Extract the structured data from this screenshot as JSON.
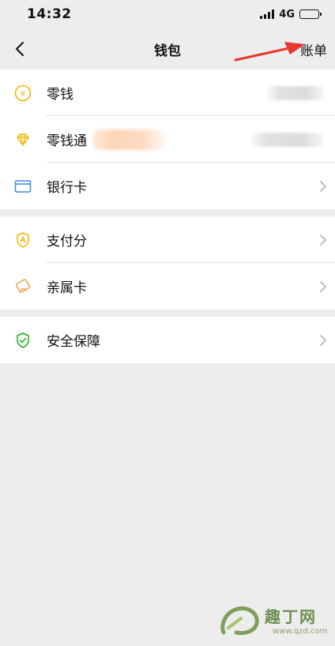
{
  "status_bar": {
    "time": "14:32",
    "network": "4G",
    "battery_level": 0.3
  },
  "nav": {
    "title": "钱包",
    "action": "账单"
  },
  "groups": [
    [
      {
        "label": "零钱",
        "icon": "yen-coin-icon"
      },
      {
        "label": "零钱通",
        "icon": "diamond-icon"
      },
      {
        "label": "银行卡",
        "icon": "bank-card-icon"
      }
    ],
    [
      {
        "label": "支付分",
        "icon": "payscore-badge-icon"
      },
      {
        "label": "亲属卡",
        "icon": "family-card-icon"
      }
    ],
    [
      {
        "label": "安全保障",
        "icon": "shield-check-icon"
      }
    ]
  ],
  "watermark": {
    "text": "趣丁网",
    "url": "www.qzd.com"
  },
  "colors": {
    "accent_yellow": "#f5b700",
    "card_blue": "#3b8ae0",
    "shield_green": "#1aad19",
    "arrow_red": "#e8382f"
  }
}
